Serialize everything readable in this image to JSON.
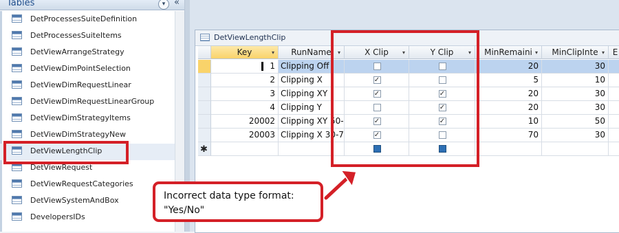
{
  "navigation": {
    "title": "Tables",
    "dropdown_glyph": "▾",
    "shutter_glyph": "«",
    "items": [
      {
        "label": "DetProcessesSuiteDefinition",
        "icon": "table-icon"
      },
      {
        "label": "DetProcessesSuiteItems",
        "icon": "table-icon"
      },
      {
        "label": "DetViewArrangeStrategy",
        "icon": "table-icon"
      },
      {
        "label": "DetViewDimPointSelection",
        "icon": "table-icon"
      },
      {
        "label": "DetViewDimRequestLinear",
        "icon": "table-icon"
      },
      {
        "label": "DetViewDimRequestLinearGroup",
        "icon": "table-icon"
      },
      {
        "label": "DetViewDimStrategyItems",
        "icon": "table-icon"
      },
      {
        "label": "DetViewDimStrategyNew",
        "icon": "table-icon"
      },
      {
        "label": "DetViewLengthClip",
        "icon": "table-icon",
        "selected": true
      },
      {
        "label": "DetViewRequest",
        "icon": "table-icon"
      },
      {
        "label": "DetViewRequestCategories",
        "icon": "table-icon"
      },
      {
        "label": "DetViewSystemAndBox",
        "icon": "table-icon"
      },
      {
        "label": "DevelopersIDs",
        "icon": "table-icon"
      }
    ]
  },
  "document_tab": {
    "label": "DetViewLengthClip",
    "icon": "table-icon"
  },
  "datasheet": {
    "columns": [
      {
        "label": "Key",
        "dropdown": "▾"
      },
      {
        "label": "RunName",
        "dropdown": "▾"
      },
      {
        "label": "X Clip",
        "dropdown": "▾"
      },
      {
        "label": "Y Clip",
        "dropdown": "▾"
      },
      {
        "label": "MinRemaini",
        "dropdown": "▾"
      },
      {
        "label": "MinClipInte",
        "dropdown": "▾"
      },
      {
        "label": "E",
        "dropdown": ""
      }
    ],
    "rows": [
      {
        "key": "1",
        "runname": "Clipping Off",
        "x_clip": false,
        "y_clip": false,
        "min_remaining": "20",
        "min_clip_interval": "30",
        "current": true
      },
      {
        "key": "2",
        "runname": "Clipping X",
        "x_clip": true,
        "y_clip": false,
        "min_remaining": "5",
        "min_clip_interval": "10"
      },
      {
        "key": "3",
        "runname": "Clipping XY",
        "x_clip": true,
        "y_clip": true,
        "min_remaining": "20",
        "min_clip_interval": "30"
      },
      {
        "key": "4",
        "runname": "Clipping Y",
        "x_clip": false,
        "y_clip": true,
        "min_remaining": "20",
        "min_clip_interval": "30"
      },
      {
        "key": "20002",
        "runname": "Clipping XY 50-",
        "x_clip": true,
        "y_clip": true,
        "min_remaining": "10",
        "min_clip_interval": "50"
      },
      {
        "key": "20003",
        "runname": "Clipping X 30-7",
        "x_clip": true,
        "y_clip": false,
        "min_remaining": "70",
        "min_clip_interval": "30"
      }
    ],
    "new_row_marker": "✱"
  },
  "annotation": {
    "line1": "Incorrect data type format:",
    "line2": "\"Yes/No\"",
    "color": "#d42027"
  }
}
